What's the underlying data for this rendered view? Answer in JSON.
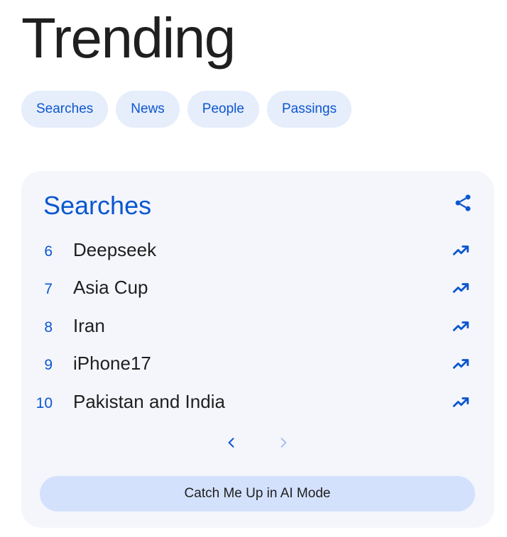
{
  "header": {
    "title": "Trending"
  },
  "chips": [
    {
      "label": "Searches"
    },
    {
      "label": "News"
    },
    {
      "label": "People"
    },
    {
      "label": "Passings"
    }
  ],
  "card": {
    "title": "Searches",
    "share_icon": "share-icon",
    "trend_icon": "trending-up-icon",
    "items": [
      {
        "rank": "6",
        "term": "Deepseek"
      },
      {
        "rank": "7",
        "term": "Asia Cup"
      },
      {
        "rank": "8",
        "term": "Iran"
      },
      {
        "rank": "9",
        "term": "iPhone17"
      },
      {
        "rank": "10",
        "term": "Pakistan and India"
      }
    ],
    "pager": {
      "prev_icon": "chevron-left-icon",
      "next_icon": "chevron-right-icon",
      "next_disabled": true
    },
    "ai_button_label": "Catch Me Up in AI Mode"
  },
  "colors": {
    "accent": "#0b57d0",
    "chip_bg": "#e6edfb",
    "card_bg": "#f4f6fc",
    "ai_button_bg": "#d3e1fd",
    "disabled": "#a8c0ee"
  }
}
